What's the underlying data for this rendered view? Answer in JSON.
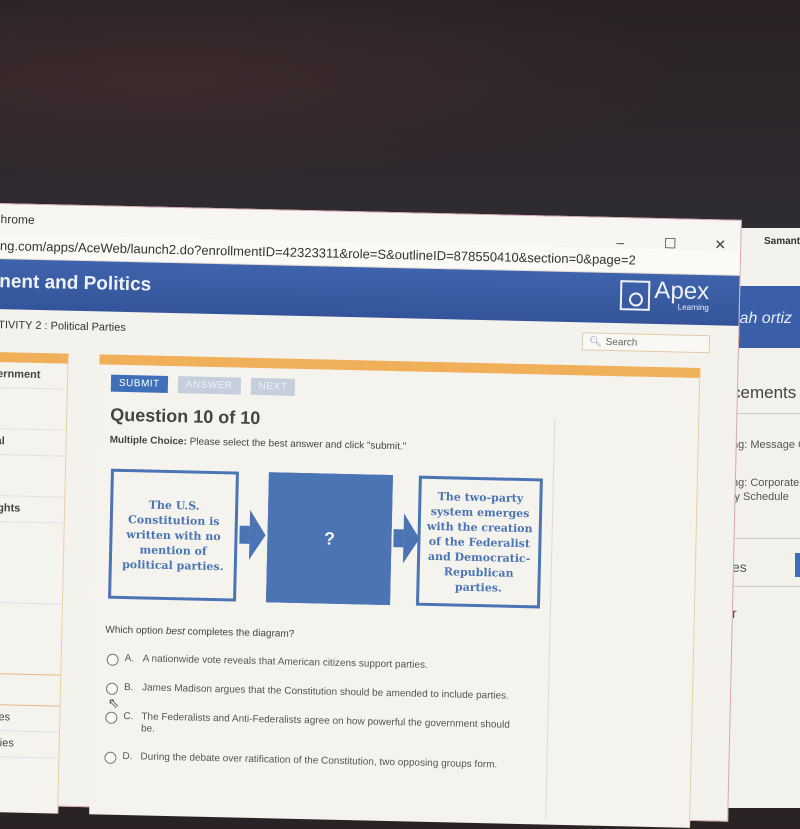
{
  "browser": {
    "app_title": "hrome",
    "url": "ng.com/apps/AceWeb/launch2.do?enrollmentID=42323311&role=S&outlineID=878550410&section=0&page=2",
    "controls": {
      "minimize": "–",
      "maximize": "☐",
      "close": "✕"
    }
  },
  "header": {
    "course_title": "nent and Politics",
    "logo": {
      "name": "Apex",
      "sub": "Learning"
    }
  },
  "subbar": {
    "activity": "TIVITY 2 : Political Parties",
    "search_placeholder": "Search"
  },
  "sidebar": {
    "items": [
      "ernment",
      "al",
      "ights",
      "rces",
      "vities"
    ]
  },
  "toolbar": {
    "submit": "SUBMIT",
    "answer": "ANSWER",
    "next": "NEXT"
  },
  "question": {
    "title": "Question 10 of 10",
    "type_label": "Multiple Choice:",
    "instructions": "Please select the best answer and click \"submit.\"",
    "prompt_pre": "Which option ",
    "prompt_em": "best",
    "prompt_post": " completes the diagram?",
    "diagram": {
      "box1": "The U.S. Constitution is written with no mention of political parties.",
      "box2": "?",
      "box3": "The two-party system emerges with the creation of the Federalist and Democratic-Republican parties."
    },
    "options": [
      {
        "letter": "A.",
        "text": "A nationwide vote reveals that American citizens support parties."
      },
      {
        "letter": "B.",
        "text": "James Madison argues that the Constitution should be amended to include parties."
      },
      {
        "letter": "C.",
        "text": "The Federalists and Anti-Federalists agree on how powerful the government should be."
      },
      {
        "letter": "D.",
        "text": "During the debate over ratification of the Constitution, two opposing groups form."
      }
    ]
  },
  "background_window": {
    "user": "Samanth",
    "username": "iah ortiz",
    "section": "cements",
    "items": [
      "ng: Message C",
      "ng: Corporate",
      "ly Schedule",
      "es",
      "r"
    ]
  }
}
